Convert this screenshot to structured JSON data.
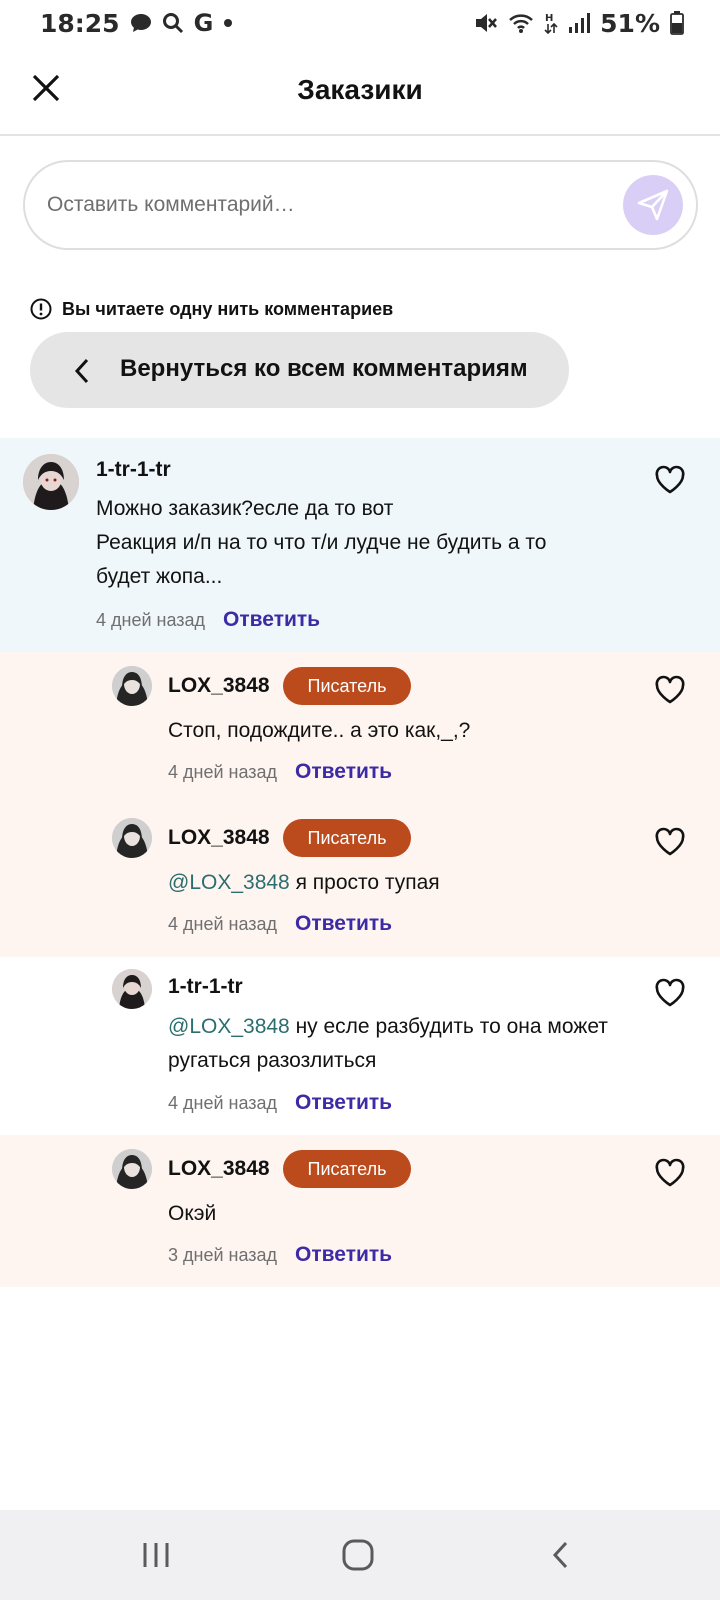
{
  "status_bar": {
    "time": "18:25",
    "battery": "51%",
    "left_icons": [
      "chat-bubble-icon",
      "search-icon",
      "google-icon",
      "dot-icon"
    ],
    "right_icons": [
      "mute-icon",
      "wifi-icon",
      "data-icon",
      "signal-icon",
      "battery-icon"
    ]
  },
  "header": {
    "title": "Заказики"
  },
  "comment_input": {
    "placeholder": "Оставить комментарий…"
  },
  "thread": {
    "notice": "Вы читаете одну нить комментариев",
    "back_label": "Вернуться ко всем комментариям"
  },
  "comments": [
    {
      "username": "1-tr-1-tr",
      "lines": [
        "Можно заказик?есле да то вот",
        "Реакция и/п на то что т/и лудче не будить а то",
        "будет жопа..."
      ],
      "time": "4 дней назад",
      "reply": "Ответить"
    },
    {
      "username": "LOX_3848",
      "badge": "Писатель",
      "lines": [
        "Стоп, подождите.. а это как,_,?"
      ],
      "time": "4 дней назад",
      "reply": "Ответить"
    },
    {
      "username": "LOX_3848",
      "badge": "Писатель",
      "mention": "@LOX_3848",
      "lines": [
        " я просто тупая"
      ],
      "time": "4 дней назад",
      "reply": "Ответить"
    },
    {
      "username": "1-tr-1-tr",
      "mention": "@LOX_3848",
      "lines": [
        " ну есле разбудить то она может",
        "ругаться разозлиться"
      ],
      "time": "4 дней назад",
      "reply": "Ответить"
    },
    {
      "username": "LOX_3848",
      "badge": "Писатель",
      "lines": [
        "Окэй"
      ],
      "time": "3 дней назад",
      "reply": "Ответить"
    }
  ],
  "colors": {
    "highlight_bg": "#eff7fb",
    "writer_bg": "#fef5f1",
    "badge": "#bb4a1c",
    "reply": "#3d2ba6",
    "mention": "#2c6e6e",
    "send_button": "#d9cff6"
  }
}
